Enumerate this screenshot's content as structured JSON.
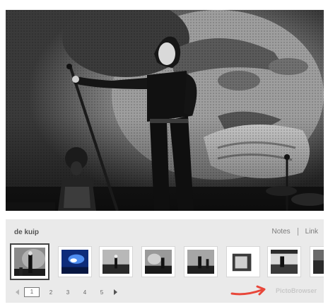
{
  "viewer": {
    "album_title": "de kuip",
    "notes_label": "Notes",
    "link_label": "Link",
    "brand_label": "PictoBrowser"
  },
  "thumbnails": [
    {
      "name": "thumb-1",
      "selected": true
    },
    {
      "name": "thumb-2",
      "selected": false
    },
    {
      "name": "thumb-3",
      "selected": false
    },
    {
      "name": "thumb-4",
      "selected": false
    },
    {
      "name": "thumb-5",
      "selected": false
    },
    {
      "name": "thumb-6",
      "selected": false
    },
    {
      "name": "thumb-7",
      "selected": false
    },
    {
      "name": "thumb-8",
      "selected": false
    }
  ],
  "pager": {
    "pages": [
      "1",
      "2",
      "3",
      "4",
      "5"
    ],
    "current": "1"
  },
  "colors": {
    "panel_background": "#eaeaea",
    "brand_arrow": "#e8473a",
    "selected_thumb_border": "#444444"
  },
  "icons": {
    "prev": "triangle-left-icon",
    "next": "triangle-right-icon",
    "brand_arrow": "curved-arrow-icon"
  }
}
